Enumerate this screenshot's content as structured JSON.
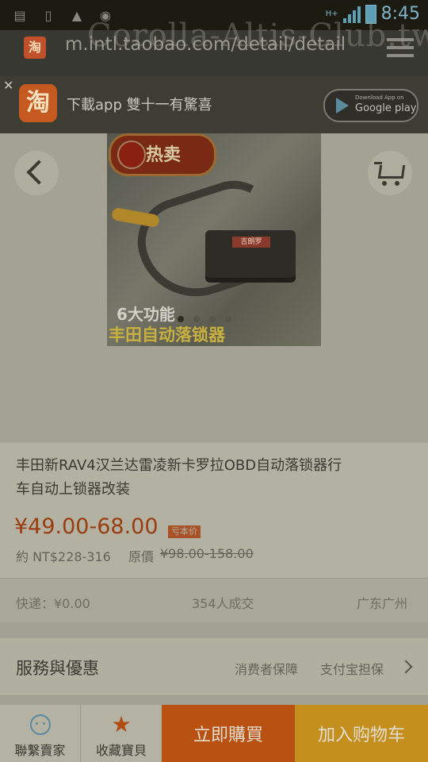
{
  "status_bar": {
    "time": "8:45",
    "network": "H+",
    "icons": [
      "notes-icon",
      "phone-icon",
      "image-icon",
      "disc-icon"
    ]
  },
  "browser": {
    "url": "m.intl.taobao.com/detail/detail",
    "watermark": "Corolla-Altis-Club.tw"
  },
  "app_banner": {
    "logo_char": "淘",
    "text": "下載app 雙十一有驚喜",
    "store_small": "Download App on",
    "store_big": "Google play"
  },
  "product_image": {
    "hot_badge": "热卖",
    "device_label": "吉朗罗",
    "caption_line1": "6大功能",
    "caption_line2": "丰田自动落锁器",
    "slide_count": 4,
    "active_slide": 1
  },
  "product": {
    "title": "丰田新RAV4汉兰达雷凌新卡罗拉OBD自动落锁器行车自动上锁器改装",
    "price": "¥49.00-68.00",
    "price_tag": "亏本价",
    "nt_price": "約 NT$228-316",
    "original_label": "原價",
    "original_price": "¥98.00-158.00"
  },
  "meta": {
    "shipping": "快递：¥0.00",
    "sold": "354人成交",
    "location": "广东广州"
  },
  "service": {
    "title": "服務與優惠",
    "guarantee1": "消费者保障",
    "guarantee2": "支付宝担保"
  },
  "bottom_bar": {
    "contact": "聯繫賣家",
    "favorite": "收藏寶貝",
    "buy_now": "立即購買",
    "add_cart": "加入购物车"
  },
  "colors": {
    "price": "#9a3d10",
    "buy_button": "#b85112",
    "cart_button": "#c48f1c"
  }
}
